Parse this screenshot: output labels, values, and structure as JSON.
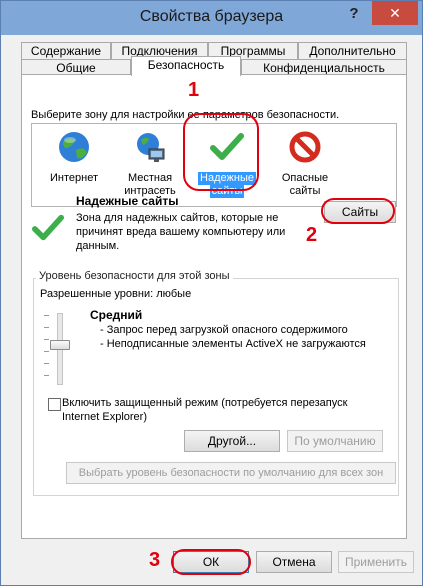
{
  "window": {
    "title": "Свойства браузера",
    "help_glyph": "?",
    "close_glyph": "✕"
  },
  "tabs": {
    "row1": [
      "Содержание",
      "Подключения",
      "Программы",
      "Дополнительно"
    ],
    "row2": [
      "Общие",
      "Безопасность",
      "Конфиденциальность"
    ],
    "active": "Безопасность"
  },
  "security": {
    "zone_prompt": "Выберите зону для настройки ее параметров безопасности.",
    "zones": [
      {
        "line1": "Интернет",
        "line2": "",
        "icon": "globe-icon"
      },
      {
        "line1": "Местная",
        "line2": "интрасеть",
        "icon": "intranet-icon"
      },
      {
        "line1": "Надежные",
        "line2": "сайты",
        "icon": "checkmark-icon",
        "selected": true
      },
      {
        "line1": "Опасные",
        "line2": "сайты",
        "icon": "restricted-icon"
      }
    ],
    "zone_info": {
      "title": "Надежные сайты",
      "description": "Зона для надежных сайтов, которые не причинят вреда вашему компьютеру или данным.",
      "sites_button": "Сайты"
    },
    "level_group": {
      "title": "Уровень безопасности для этой зоны",
      "allowed_levels": "Разрешенные уровни: любые",
      "level_name": "Средний",
      "bullets": [
        "- Запрос перед загрузкой опасного содержимого",
        "- Неподписанные элементы ActiveX не загружаются"
      ],
      "protected_mode_label_line1": "Включить защищенный режим (потребуется перезапуск",
      "protected_mode_label_line2": "Internet Explorer)",
      "protected_mode_checked": false,
      "custom_button": "Другой...",
      "default_button": "По умолчанию"
    },
    "reset_all_button": "Выбрать уровень безопасности по умолчанию для всех зон"
  },
  "annotations": {
    "n1": "1",
    "n2": "2",
    "n3": "3",
    "color": "#e0000e"
  },
  "footer": {
    "ok": "ОК",
    "cancel": "Отмена",
    "apply": "Применить"
  }
}
